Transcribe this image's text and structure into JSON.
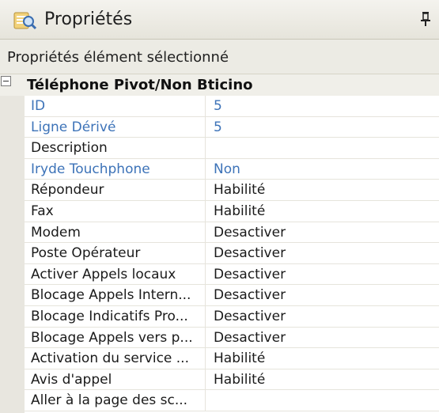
{
  "window": {
    "title": "Propriétés",
    "icon": "properties-icon",
    "pin_icon": "pin-icon"
  },
  "subheader": {
    "label": "Propriétés élément sélectionné"
  },
  "category": {
    "label": "Téléphone Pivot/Non Bticino",
    "expanded": true
  },
  "colors": {
    "readonly_text": "#3d73b8",
    "normal_text": "#1a1a1a",
    "gutter": "#e8e6df",
    "header_bg": "#ecebe4"
  },
  "properties": [
    {
      "name": "ID",
      "value": "5",
      "readonly": true
    },
    {
      "name": "Ligne Dérivé",
      "value": "5",
      "readonly": true
    },
    {
      "name": "Description",
      "value": "",
      "readonly": false
    },
    {
      "name": "Iryde Touchphone",
      "value": "Non",
      "readonly": true
    },
    {
      "name": "Répondeur",
      "value": "Habilité",
      "readonly": false
    },
    {
      "name": "Fax",
      "value": "Habilité",
      "readonly": false
    },
    {
      "name": "Modem",
      "value": "Desactiver",
      "readonly": false
    },
    {
      "name": "Poste Opérateur",
      "value": "Desactiver",
      "readonly": false
    },
    {
      "name": "Activer Appels locaux",
      "value": "Desactiver",
      "readonly": false
    },
    {
      "name": "Blocage Appels Intern...",
      "value": "Desactiver",
      "readonly": false
    },
    {
      "name": "Blocage Indicatifs Pro...",
      "value": "Desactiver",
      "readonly": false
    },
    {
      "name": "Blocage Appels vers p...",
      "value": "Desactiver",
      "readonly": false
    },
    {
      "name": "Activation du service ...",
      "value": "Habilité",
      "readonly": false
    },
    {
      "name": "Avis d'appel",
      "value": "Habilité",
      "readonly": false
    },
    {
      "name": "Aller à la page des sc...",
      "value": "",
      "readonly": false
    }
  ]
}
